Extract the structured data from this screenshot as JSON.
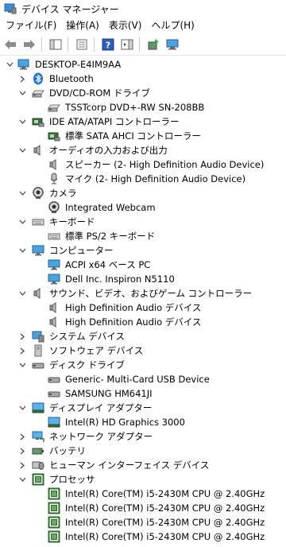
{
  "window": {
    "title": "デバイス マネージャー"
  },
  "menu": [
    "ファイル(F)",
    "操作(A)",
    "表示(V)",
    "ヘルプ(H)"
  ],
  "toolbar": {
    "buttons": [
      "back-icon",
      "forward-icon",
      "show-hide-console-tree-icon",
      "properties-icon",
      "help-icon",
      "action-pane-icon",
      "update-driver-icon",
      "scan-hardware-icon"
    ]
  },
  "tree": {
    "root": "DESKTOP-E4IM9AA",
    "items": [
      {
        "label": "Bluetooth",
        "level": 1,
        "expanded": false,
        "icon": "bluetooth-icon"
      },
      {
        "label": "DVD/CD-ROM ドライブ",
        "level": 1,
        "expanded": true,
        "icon": "dvd-drive-icon"
      },
      {
        "label": "TSSTcorp DVD+-RW SN-208BB",
        "level": 2,
        "icon": "dvd-drive-icon"
      },
      {
        "label": "IDE ATA/ATAPI コントローラー",
        "level": 1,
        "expanded": true,
        "icon": "ide-controller-icon"
      },
      {
        "label": "標準 SATA AHCI コントローラー",
        "level": 2,
        "icon": "ide-controller-icon"
      },
      {
        "label": "オーディオの入力および出力",
        "level": 1,
        "expanded": true,
        "icon": "speaker-icon"
      },
      {
        "label": "スピーカー (2- High Definition Audio Device)",
        "level": 2,
        "icon": "speaker-icon"
      },
      {
        "label": "マイク (2- High Definition Audio Device)",
        "level": 2,
        "icon": "microphone-icon"
      },
      {
        "label": "カメラ",
        "level": 1,
        "expanded": true,
        "icon": "camera-icon"
      },
      {
        "label": "Integrated Webcam",
        "level": 2,
        "icon": "camera-icon"
      },
      {
        "label": "キーボード",
        "level": 1,
        "expanded": true,
        "icon": "keyboard-icon"
      },
      {
        "label": "標準 PS/2 キーボード",
        "level": 2,
        "icon": "keyboard-icon"
      },
      {
        "label": "コンピューター",
        "level": 1,
        "expanded": true,
        "icon": "computer-icon"
      },
      {
        "label": "ACPI x64 ベース PC",
        "level": 2,
        "icon": "computer-icon"
      },
      {
        "label": "Dell Inc. Inspiron N5110",
        "level": 2,
        "icon": "computer-icon"
      },
      {
        "label": "サウンド、ビデオ、およびゲーム コントローラー",
        "level": 1,
        "expanded": true,
        "icon": "speaker-icon"
      },
      {
        "label": "High Definition Audio デバイス",
        "level": 2,
        "icon": "speaker-icon"
      },
      {
        "label": "High Definition Audio デバイス",
        "level": 2,
        "icon": "speaker-icon"
      },
      {
        "label": "システム デバイス",
        "level": 1,
        "expanded": false,
        "icon": "system-devices-icon"
      },
      {
        "label": "ソフトウェア デバイス",
        "level": 1,
        "expanded": false,
        "icon": "software-device-icon"
      },
      {
        "label": "ディスク ドライブ",
        "level": 1,
        "expanded": true,
        "icon": "disk-drive-icon"
      },
      {
        "label": "Generic- Multi-Card USB Device",
        "level": 2,
        "icon": "disk-drive-icon"
      },
      {
        "label": "SAMSUNG HM641JI",
        "level": 2,
        "icon": "disk-drive-icon"
      },
      {
        "label": "ディスプレイ アダプター",
        "level": 1,
        "expanded": true,
        "icon": "display-adapter-icon"
      },
      {
        "label": "Intel(R) HD Graphics 3000",
        "level": 2,
        "icon": "display-adapter-icon"
      },
      {
        "label": "ネットワーク アダプター",
        "level": 1,
        "expanded": false,
        "icon": "network-adapter-icon"
      },
      {
        "label": "バッテリ",
        "level": 1,
        "expanded": false,
        "icon": "battery-icon"
      },
      {
        "label": "ヒューマン インターフェイス デバイス",
        "level": 1,
        "expanded": false,
        "icon": "hid-icon"
      },
      {
        "label": "プロセッサ",
        "level": 1,
        "expanded": true,
        "icon": "processor-icon"
      },
      {
        "label": "Intel(R) Core(TM) i5-2430M CPU @ 2.40GHz",
        "level": 2,
        "icon": "processor-icon"
      },
      {
        "label": "Intel(R) Core(TM) i5-2430M CPU @ 2.40GHz",
        "level": 2,
        "icon": "processor-icon"
      },
      {
        "label": "Intel(R) Core(TM) i5-2430M CPU @ 2.40GHz",
        "level": 2,
        "icon": "processor-icon"
      },
      {
        "label": "Intel(R) Core(TM) i5-2430M CPU @ 2.40GHz",
        "level": 2,
        "icon": "processor-icon"
      }
    ]
  }
}
